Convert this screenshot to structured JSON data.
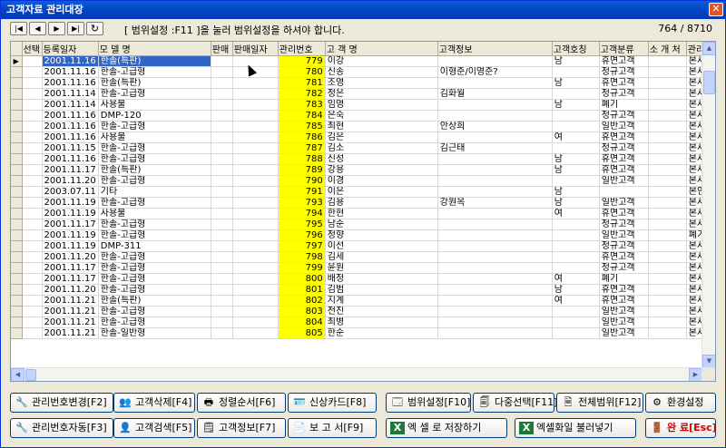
{
  "window": {
    "title": "고객자료 관리대장",
    "close_label": "✕"
  },
  "nav": {
    "first": "|◀",
    "prev": "◀",
    "next": "▶",
    "last": "▶|",
    "refresh": "↻"
  },
  "hint": "[ 범위설정 :F11 ]을 눌러 범위설정을 하셔야 합니다.",
  "record_count": "764 / 8710",
  "columns": [
    "선택",
    "등록일자",
    "모 델 명",
    "판매",
    "판매일자",
    "관리번호",
    "고 객 명",
    "고객정보",
    "고객호칭",
    "고객분류",
    "소 개 처",
    "관리"
  ],
  "rows": [
    {
      "date": "2001.11.16",
      "model": "한솔(특판)",
      "no": "779",
      "name": "이강",
      "info": "",
      "title": "남",
      "class": "휴면고객",
      "mgr": "본사",
      "current": true
    },
    {
      "date": "2001.11.16",
      "model": "한솔-고급형",
      "no": "780",
      "name": "신송",
      "info": "이형준/이영준?",
      "title": "",
      "class": "정규고객",
      "mgr": "본사"
    },
    {
      "date": "2001.11.16",
      "model": "한솔(특판)",
      "no": "781",
      "name": "조영",
      "info": "",
      "title": "남",
      "class": "휴면고객",
      "mgr": "본사"
    },
    {
      "date": "2001.11.14",
      "model": "한솔-고급형",
      "no": "782",
      "name": "정은",
      "info": "김화월",
      "title": "",
      "class": "정규고객",
      "mgr": "본사"
    },
    {
      "date": "2001.11.14",
      "model": "사용불",
      "no": "783",
      "name": "임영",
      "info": "",
      "title": "남",
      "class": "폐기",
      "mgr": "본사"
    },
    {
      "date": "2001.11.16",
      "model": "DMP-120",
      "no": "784",
      "name": "은숙",
      "info": "",
      "title": "",
      "class": "정규고객",
      "mgr": "본사"
    },
    {
      "date": "2001.11.16",
      "model": "한솔-고급형",
      "no": "785",
      "name": "최현",
      "info": "안상희",
      "title": "",
      "class": "일반고객",
      "mgr": "본사"
    },
    {
      "date": "2001.11.16",
      "model": "사용불",
      "no": "786",
      "name": "김은",
      "info": "",
      "title": "여",
      "class": "휴면고객",
      "mgr": "본사"
    },
    {
      "date": "2001.11.15",
      "model": "한솔-고급형",
      "no": "787",
      "name": "김소",
      "info": "김근태",
      "title": "",
      "class": "정규고객",
      "mgr": "본사"
    },
    {
      "date": "2001.11.16",
      "model": "한솔-고급형",
      "no": "788",
      "name": "신성",
      "info": "",
      "title": "남",
      "class": "휴면고객",
      "mgr": "본사"
    },
    {
      "date": "2001.11.17",
      "model": "한솔(특판)",
      "no": "789",
      "name": "강용",
      "info": "",
      "title": "남",
      "class": "휴면고객",
      "mgr": "본사"
    },
    {
      "date": "2001.11.20",
      "model": "한솔-고급형",
      "no": "790",
      "name": "이경",
      "info": "",
      "title": "",
      "class": "일반고객",
      "mgr": "본사"
    },
    {
      "date": "2003.07.11",
      "model": "기타",
      "no": "791",
      "name": "이은",
      "info": "",
      "title": "남",
      "class": "",
      "mgr": "본인"
    },
    {
      "date": "2001.11.19",
      "model": "한솔-고급형",
      "no": "793",
      "name": "김용",
      "info": "강원옥",
      "title": "남",
      "class": "일반고객",
      "mgr": "본사"
    },
    {
      "date": "2001.11.19",
      "model": "사용불",
      "no": "794",
      "name": "한현",
      "info": "",
      "title": "여",
      "class": "휴면고객",
      "mgr": "본사"
    },
    {
      "date": "2001.11.17",
      "model": "한솔-고급형",
      "no": "795",
      "name": "남순",
      "info": "",
      "title": "",
      "class": "정규고객",
      "mgr": "본사"
    },
    {
      "date": "2001.11.19",
      "model": "한솔-고급형",
      "no": "796",
      "name": "정향",
      "info": "",
      "title": "",
      "class": "일반고객",
      "mgr": "폐기"
    },
    {
      "date": "2001.11.19",
      "model": "DMP-311",
      "no": "797",
      "name": "이선",
      "info": "",
      "title": "",
      "class": "정규고객",
      "mgr": "본사"
    },
    {
      "date": "2001.11.20",
      "model": "한솔-고급형",
      "no": "798",
      "name": "김세",
      "info": "",
      "title": "",
      "class": "휴면고객",
      "mgr": "본사"
    },
    {
      "date": "2001.11.17",
      "model": "한솔-고급형",
      "no": "799",
      "name": "윤원",
      "info": "",
      "title": "",
      "class": "정규고객",
      "mgr": "본사"
    },
    {
      "date": "2001.11.17",
      "model": "한솔-고급형",
      "no": "800",
      "name": "배정",
      "info": "",
      "title": "여",
      "class": "폐기",
      "mgr": "본사"
    },
    {
      "date": "2001.11.20",
      "model": "한솔-고급형",
      "no": "801",
      "name": "김범",
      "info": "",
      "title": "남",
      "class": "휴면고객",
      "mgr": "본사"
    },
    {
      "date": "2001.11.21",
      "model": "한솔(특판)",
      "no": "802",
      "name": "지계",
      "info": "",
      "title": "여",
      "class": "휴면고객",
      "mgr": "본사"
    },
    {
      "date": "2001.11.21",
      "model": "한솔-고급형",
      "no": "803",
      "name": "전진",
      "info": "",
      "title": "",
      "class": "일반고객",
      "mgr": "본사"
    },
    {
      "date": "2001.11.21",
      "model": "한솔-고급형",
      "no": "804",
      "name": "최병",
      "info": "",
      "title": "",
      "class": "일반고객",
      "mgr": "본사"
    },
    {
      "date": "2001.11.21",
      "model": "한솔-일반형",
      "no": "805",
      "name": "한순",
      "info": "",
      "title": "",
      "class": "일반고객",
      "mgr": "본사"
    }
  ],
  "buttons": {
    "row1": [
      {
        "label": "관리번호변경[F2]",
        "icon": "wrench-icon",
        "glyph": "🔧"
      },
      {
        "label": "고객삭제[F4]",
        "icon": "users-delete-icon",
        "glyph": "👥"
      },
      {
        "label": "정렬순서[F6]",
        "icon": "sort-icon",
        "glyph": "🖶"
      },
      {
        "label": "신상카드[F8]",
        "icon": "id-card-icon",
        "glyph": "🪪"
      },
      {
        "label": "범위설정[F10]",
        "icon": "range-icon",
        "glyph": "🗔"
      },
      {
        "label": "다중선택[F11]",
        "icon": "multi-select-icon",
        "glyph": "🗐"
      },
      {
        "label": "전체범위[F12]",
        "icon": "all-range-icon",
        "glyph": "🗎"
      },
      {
        "label": "환경설정",
        "icon": "settings-icon",
        "glyph": "⚙"
      }
    ],
    "row2": [
      {
        "label": "관리번호자동[F3]",
        "icon": "wrench-auto-icon",
        "glyph": "🔧"
      },
      {
        "label": "고객검색[F5]",
        "icon": "user-search-icon",
        "glyph": "👤"
      },
      {
        "label": "고객정보[F7]",
        "icon": "user-info-icon",
        "glyph": "🗒"
      },
      {
        "label": "보 고 서[F9]",
        "icon": "report-icon",
        "glyph": "📄"
      },
      {
        "label": "엑 셀 로 저장하기",
        "icon": "excel-save-icon",
        "glyph": "X"
      },
      {
        "label": "엑셀화일 불러넣기",
        "icon": "excel-load-icon",
        "glyph": "X"
      },
      {
        "label": "완 료[Esc]",
        "icon": "exit-door-icon",
        "glyph": "🚪",
        "accent": "#cc0000"
      }
    ]
  }
}
